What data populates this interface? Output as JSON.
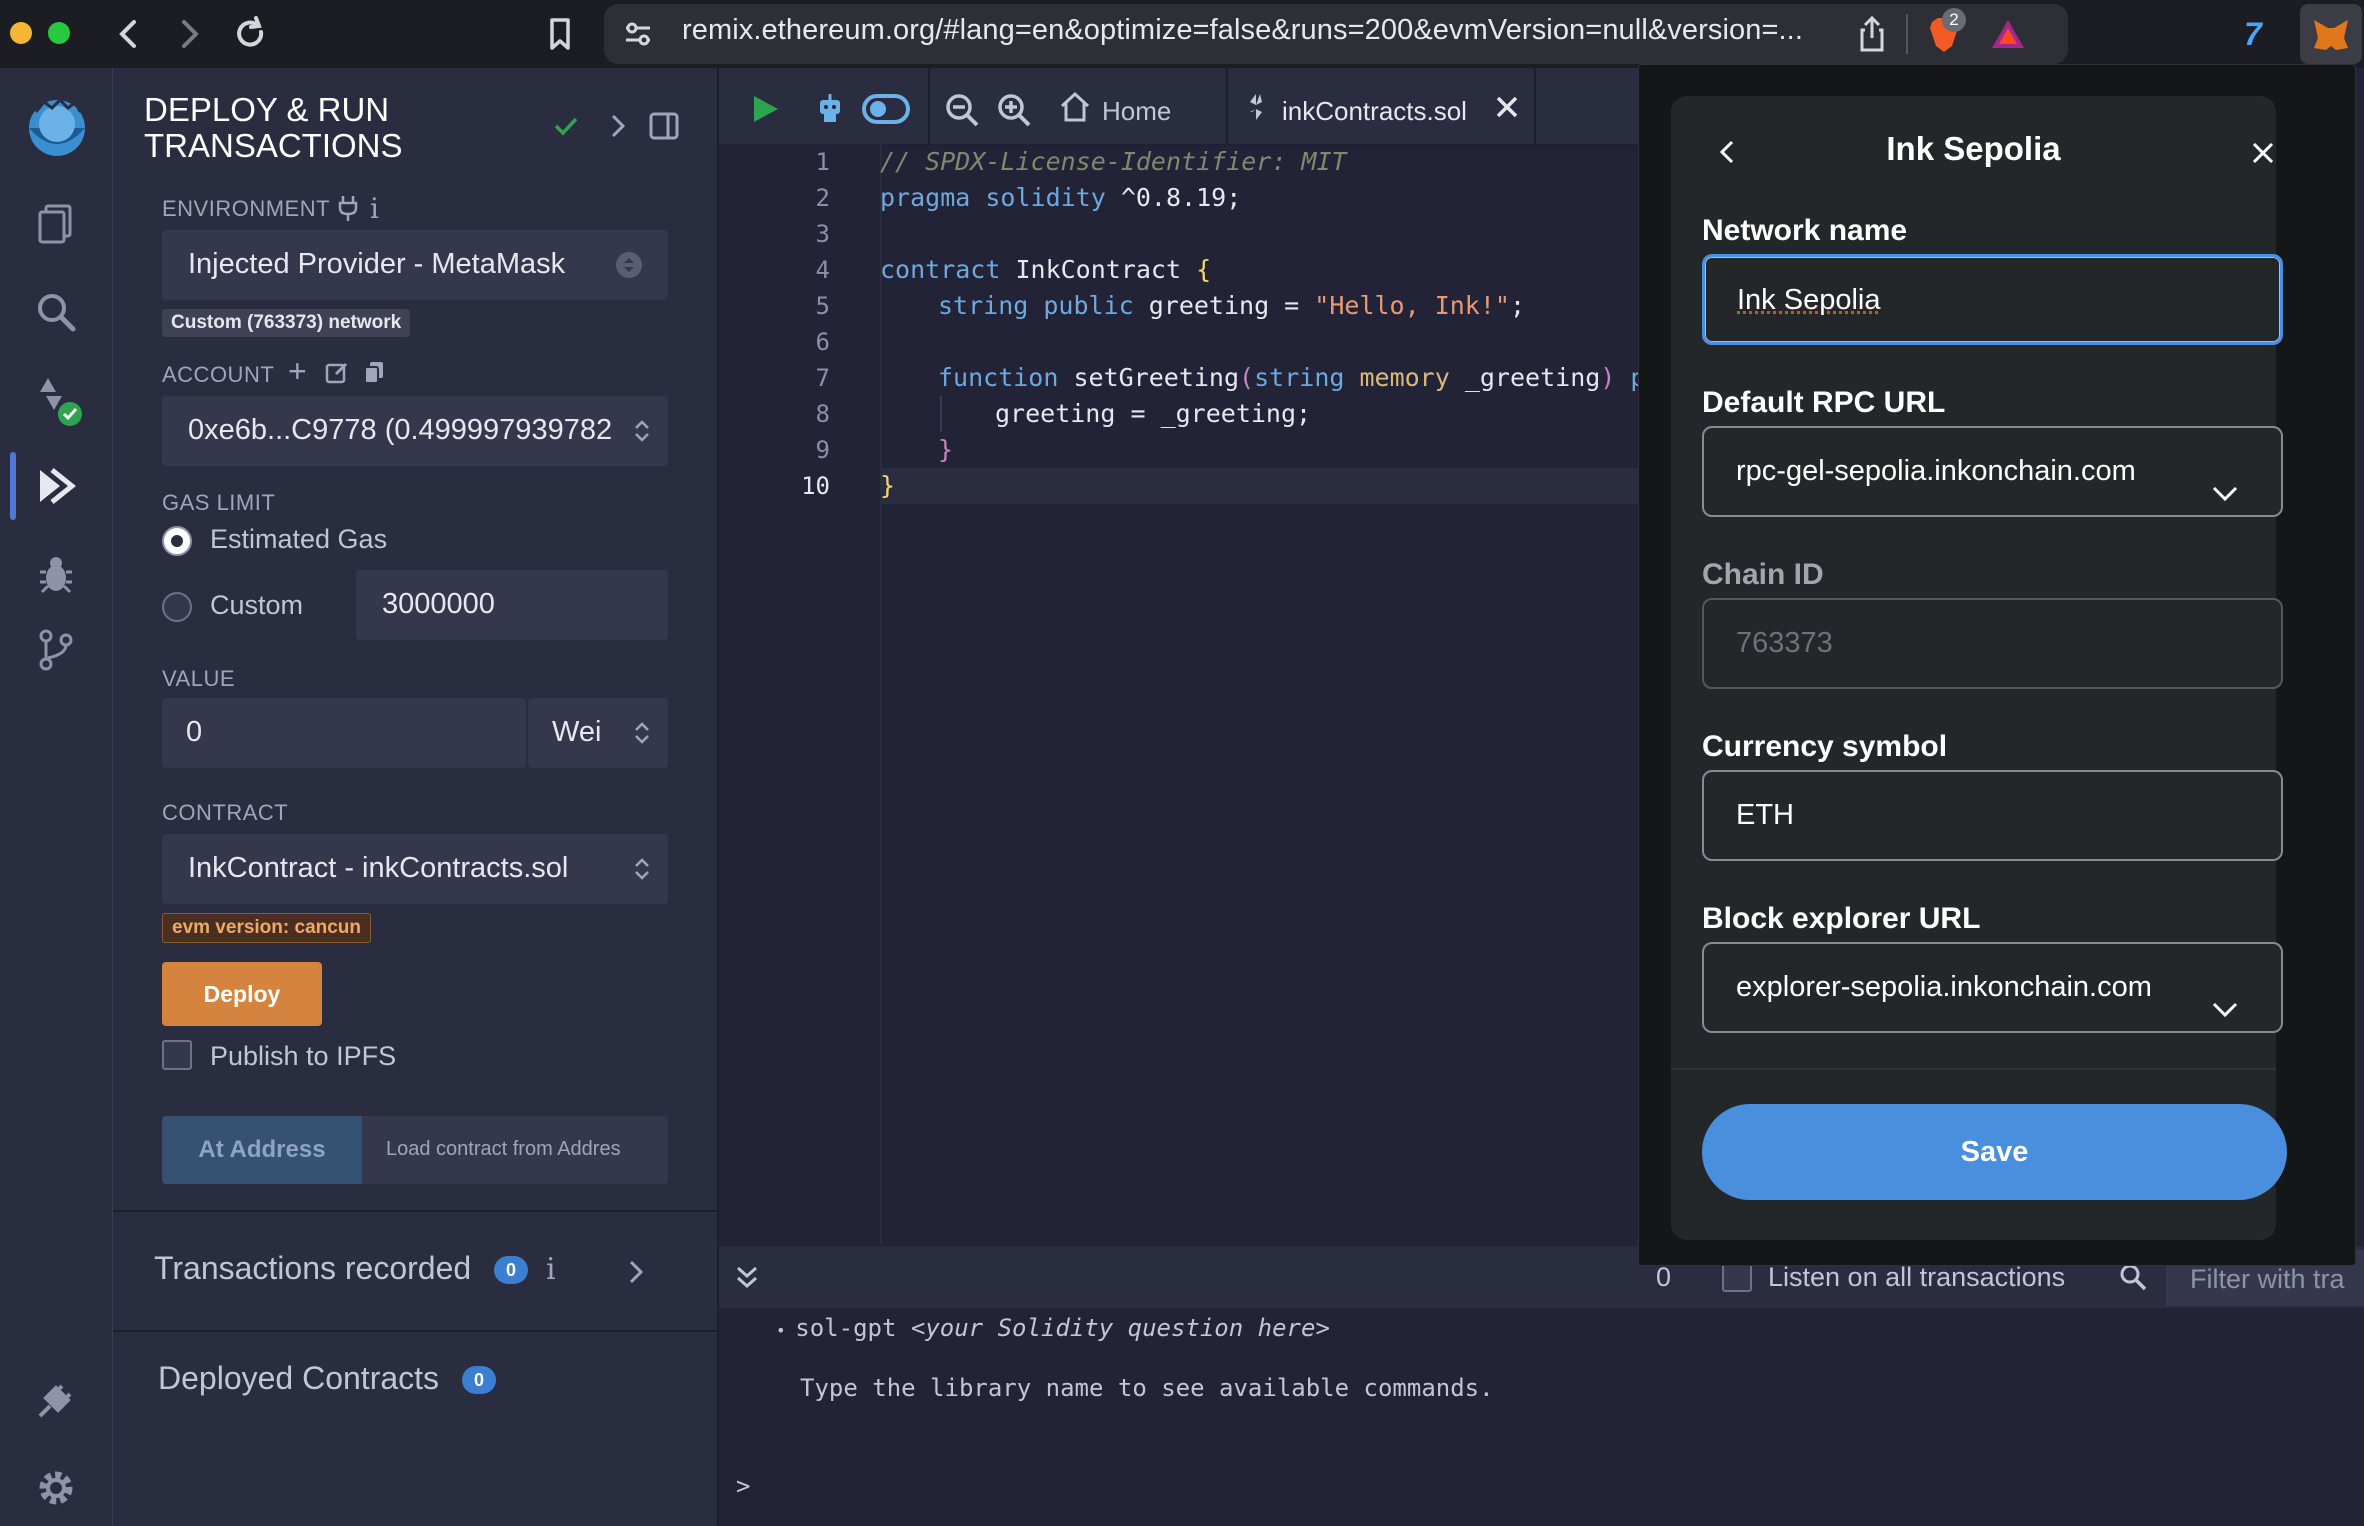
{
  "browser": {
    "url": "remix.ethereum.org/#lang=en&optimize=false&runs=200&evmVersion=null&version=...",
    "extension_badge": "2"
  },
  "side_panel": {
    "title_line1": "DEPLOY & RUN",
    "title_line2": "TRANSACTIONS",
    "environment_label": "ENVIRONMENT",
    "environment_value": "Injected Provider - MetaMask",
    "network_badge": "Custom (763373) network",
    "account_label": "ACCOUNT",
    "account_value": "0xe6b...C9778 (0.499997939782",
    "gas_limit_label": "GAS LIMIT",
    "gas_estimated": "Estimated Gas",
    "gas_custom": "Custom",
    "gas_custom_value": "3000000",
    "value_label": "VALUE",
    "value_amount": "0",
    "value_unit": "Wei",
    "contract_label": "CONTRACT",
    "contract_value": "InkContract - inkContracts.sol",
    "evm_badge": "evm version: cancun",
    "deploy_button": "Deploy",
    "publish_ipfs": "Publish to IPFS",
    "at_address_button": "At Address",
    "load_contract_placeholder": "Load contract from Addres",
    "transactions_recorded": "Transactions recorded",
    "transactions_count": "0",
    "deployed_contracts": "Deployed Contracts",
    "deployed_count": "0"
  },
  "editor": {
    "home_tab": "Home",
    "file_tab": "inkContracts.sol",
    "line_numbers": [
      "1",
      "2",
      "3",
      "4",
      "5",
      "6",
      "7",
      "8",
      "9",
      "10"
    ],
    "code": {
      "l1": "// SPDX-License-Identifier: MIT",
      "l2_kw": "pragma solidity",
      "l2_rest": " ^0.8.19;",
      "l4_kw": "contract",
      "l4_name": " InkContract ",
      "l4_brace": "{",
      "l5_kw": "string public",
      "l5_name": " greeting = ",
      "l5_str": "\"Hello, Ink!\"",
      "l5_end": ";",
      "l7_kw": "function",
      "l7_name": " setGreeting",
      "l7_paren": "(",
      "l7_type": "string",
      "l7_mem": " memory",
      "l7_arg": " _greeting",
      "l7_paren2": ")",
      "l7_pub": " pul",
      "l8": "greeting = _greeting;",
      "l9": "}",
      "l10": "}"
    }
  },
  "terminal": {
    "tx_count": "0",
    "listen_label": "Listen on all transactions",
    "filter_placeholder": "Filter with tra",
    "bullet_cmd": "sol-gpt",
    "bullet_hint": "<your Solidity question here>",
    "info_line": "Type the library name to see available commands.",
    "prompt": ">"
  },
  "metamask": {
    "title": "Ink Sepolia",
    "network_name_label": "Network name",
    "network_name_value": "Ink Sepolia",
    "rpc_label": "Default RPC URL",
    "rpc_value": "rpc-gel-sepolia.inkonchain.com",
    "chain_id_label": "Chain ID",
    "chain_id_value": "763373",
    "currency_label": "Currency symbol",
    "currency_value": "ETH",
    "explorer_label": "Block explorer URL",
    "explorer_value": "explorer-sepolia.inkonchain.com",
    "save_button": "Save",
    "accent": "#4a8fde"
  }
}
